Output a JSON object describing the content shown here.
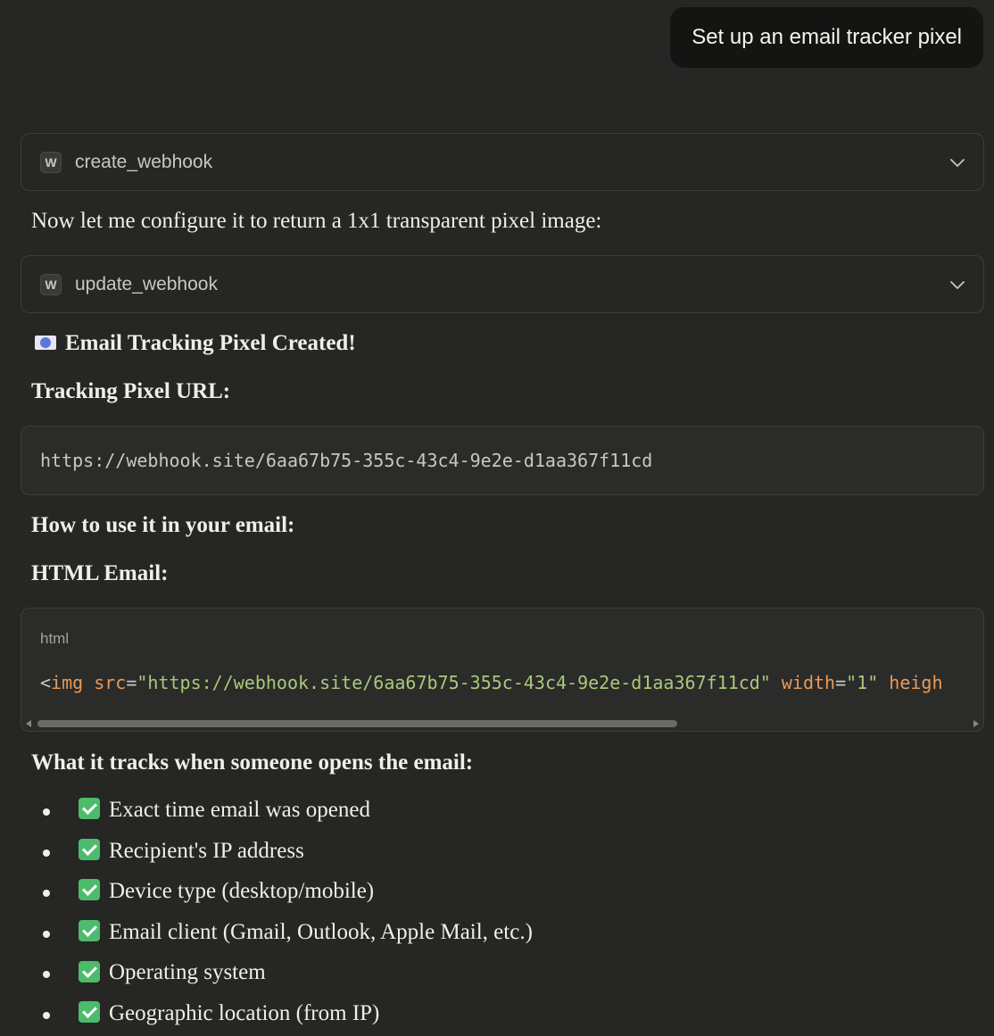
{
  "user_message": "Set up an email tracker pixel",
  "tool_calls": [
    {
      "icon_letter": "W",
      "name": "create_webhook"
    },
    {
      "icon_letter": "W",
      "name": "update_webhook"
    }
  ],
  "intro_text": "Now let me configure it to return a 1x1 transparent pixel image:",
  "heading_created": "Email Tracking Pixel Created!",
  "heading_url": "Tracking Pixel URL:",
  "tracking_url": "https://webhook.site/6aa67b75-355c-43c4-9e2e-d1aa367f11cd",
  "heading_howto": "How to use it in your email:",
  "heading_html_email": "HTML Email:",
  "code_block": {
    "language": "html",
    "tokens": {
      "open": "<",
      "tag": "img",
      "attr_src": "src",
      "eq1": "=",
      "val_src": "\"https://webhook.site/6aa67b75-355c-43c4-9e2e-d1aa367f11cd\"",
      "attr_width": "width",
      "eq2": "=",
      "val_width": "\"1\"",
      "attr_height_partial": "heigh"
    }
  },
  "heading_tracks": "What it tracks when someone opens the email:",
  "tracked_items": [
    "Exact time email was opened",
    "Recipient's IP address",
    "Device type (desktop/mobile)",
    "Email client (Gmail, Outlook, Apple Mail, etc.)",
    "Operating system",
    "Geographic location (from IP)"
  ],
  "icons": {
    "tool_chevron": "chevron-down-icon",
    "heading_emoji": "email-pixel-icon",
    "check": "check-mark-icon"
  },
  "colors": {
    "background": "#262624",
    "user_bubble": "#141413",
    "code_tag": "#e89a5a",
    "code_string": "#a8c97a",
    "check_green": "#4cbb6c"
  }
}
